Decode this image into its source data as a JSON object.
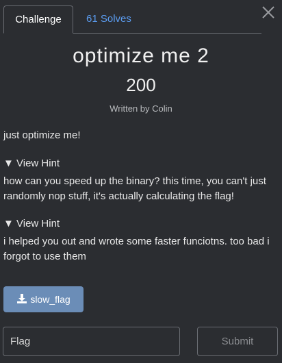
{
  "tabs": [
    {
      "label": "Challenge"
    },
    {
      "label": "61 Solves"
    }
  ],
  "challenge": {
    "name": "optimize me 2",
    "value": "200",
    "author": "Written by Colin",
    "description": "just optimize me!"
  },
  "hints": [
    {
      "toggle": "▼ View Hint",
      "text": "how can you speed up the binary? this time, you can't just randomly nop stuff, it's actually calculating the flag!"
    },
    {
      "toggle": "▼ View Hint",
      "text": "i helped you out and wrote some faster funciotns. too bad i forgot to use them"
    }
  ],
  "file": {
    "label": "slow_flag",
    "icon": "download-icon"
  },
  "form": {
    "placeholder": "Flag",
    "submit_label": "Submit"
  },
  "icons": {
    "close": "close-icon"
  },
  "colors": {
    "background": "#2b2d31",
    "link": "#5b9cf0",
    "button": "#6b8db7"
  }
}
